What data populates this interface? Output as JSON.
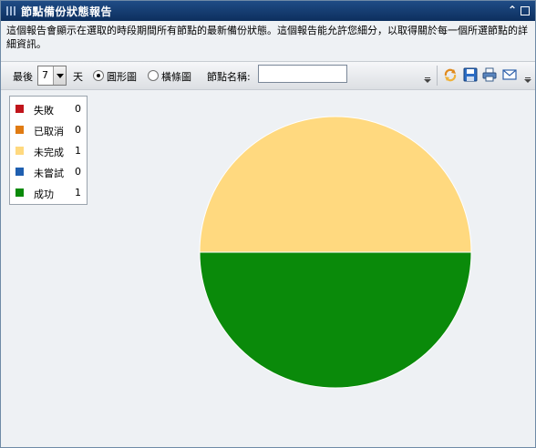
{
  "window": {
    "title": "節點備份狀態報告",
    "collapse_glyph": "⌃"
  },
  "description": "這個報告會顯示在選取的時段期間所有節點的最新備份狀態。這個報告能允許您細分，以取得關於每一個所選節點的詳細資訊。",
  "toolbar": {
    "last_label": "最後",
    "days_value": "7",
    "days_unit": "天",
    "pie_label": "圓形圖",
    "bar_label": "橫條圖",
    "node_name_label": "節點名稱:",
    "node_name_value": ""
  },
  "colors": {
    "failed": "#c0141b",
    "cancelled": "#e07b12",
    "incomplete": "#ffd97f",
    "not_attempted": "#1f5fb0",
    "success": "#0a8a0a"
  },
  "legend": {
    "items": [
      {
        "label": "失敗",
        "count": "0",
        "color": "#c0141b"
      },
      {
        "label": "已取消",
        "count": "0",
        "color": "#e07b12"
      },
      {
        "label": "未完成",
        "count": "1",
        "color": "#ffd97f"
      },
      {
        "label": "未嘗試",
        "count": "0",
        "color": "#1f5fb0"
      },
      {
        "label": "成功",
        "count": "1",
        "color": "#0a8a0a"
      }
    ]
  },
  "chart_data": {
    "type": "pie",
    "categories": [
      "失敗",
      "已取消",
      "未完成",
      "未嘗試",
      "成功"
    ],
    "values": [
      0,
      0,
      1,
      0,
      1
    ],
    "colors": [
      "#c0141b",
      "#e07b12",
      "#ffd97f",
      "#1f5fb0",
      "#0a8a0a"
    ]
  },
  "icons": [
    "grip-icon",
    "collapse-icon",
    "maximize-icon",
    "refresh-icon",
    "save-icon",
    "print-icon",
    "email-icon"
  ]
}
